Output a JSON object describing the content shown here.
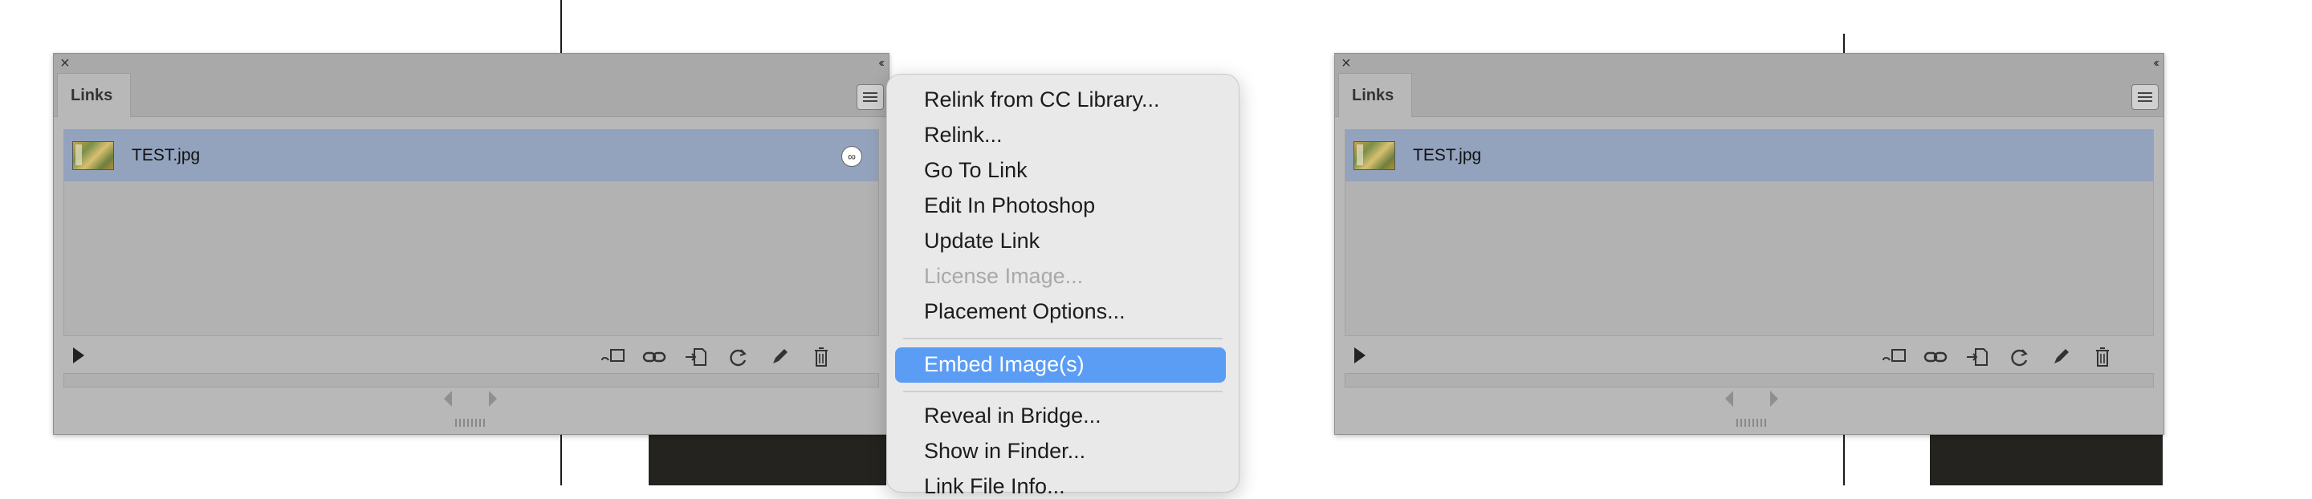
{
  "left_panel": {
    "tab_label": "Links",
    "file_name": "TEST.jpg"
  },
  "right_panel": {
    "tab_label": "Links",
    "file_name": "TEST.jpg"
  },
  "context_menu": {
    "items": [
      {
        "label": "Relink from CC Library...",
        "enabled": true
      },
      {
        "label": "Relink...",
        "enabled": true
      },
      {
        "label": "Go To Link",
        "enabled": true
      },
      {
        "label": "Edit In Photoshop",
        "enabled": true
      },
      {
        "label": "Update Link",
        "enabled": true
      },
      {
        "label": "License Image...",
        "enabled": false
      },
      {
        "label": "Placement Options...",
        "enabled": true
      },
      {
        "label": "Embed Image(s)",
        "enabled": true,
        "highlighted": true
      },
      {
        "label": "Reveal in Bridge...",
        "enabled": true
      },
      {
        "label": "Show in Finder...",
        "enabled": true
      },
      {
        "label": "Link File Info...",
        "enabled": true
      }
    ]
  },
  "icons": [
    "close-icon",
    "collapse-icon",
    "panel-menu-icon",
    "link-status-icon",
    "expand-arrow-icon",
    "relink-cc-icon",
    "relink-icon",
    "go-to-link-icon",
    "update-link-icon",
    "edit-original-icon",
    "delete-icon",
    "scroll-left-icon",
    "scroll-right-icon"
  ],
  "colors": {
    "panel_bg": "#b8b8b8",
    "selected_row": "#93a3bd",
    "menu_bg": "#e9e9ea",
    "menu_highlight": "#5b9df5"
  }
}
